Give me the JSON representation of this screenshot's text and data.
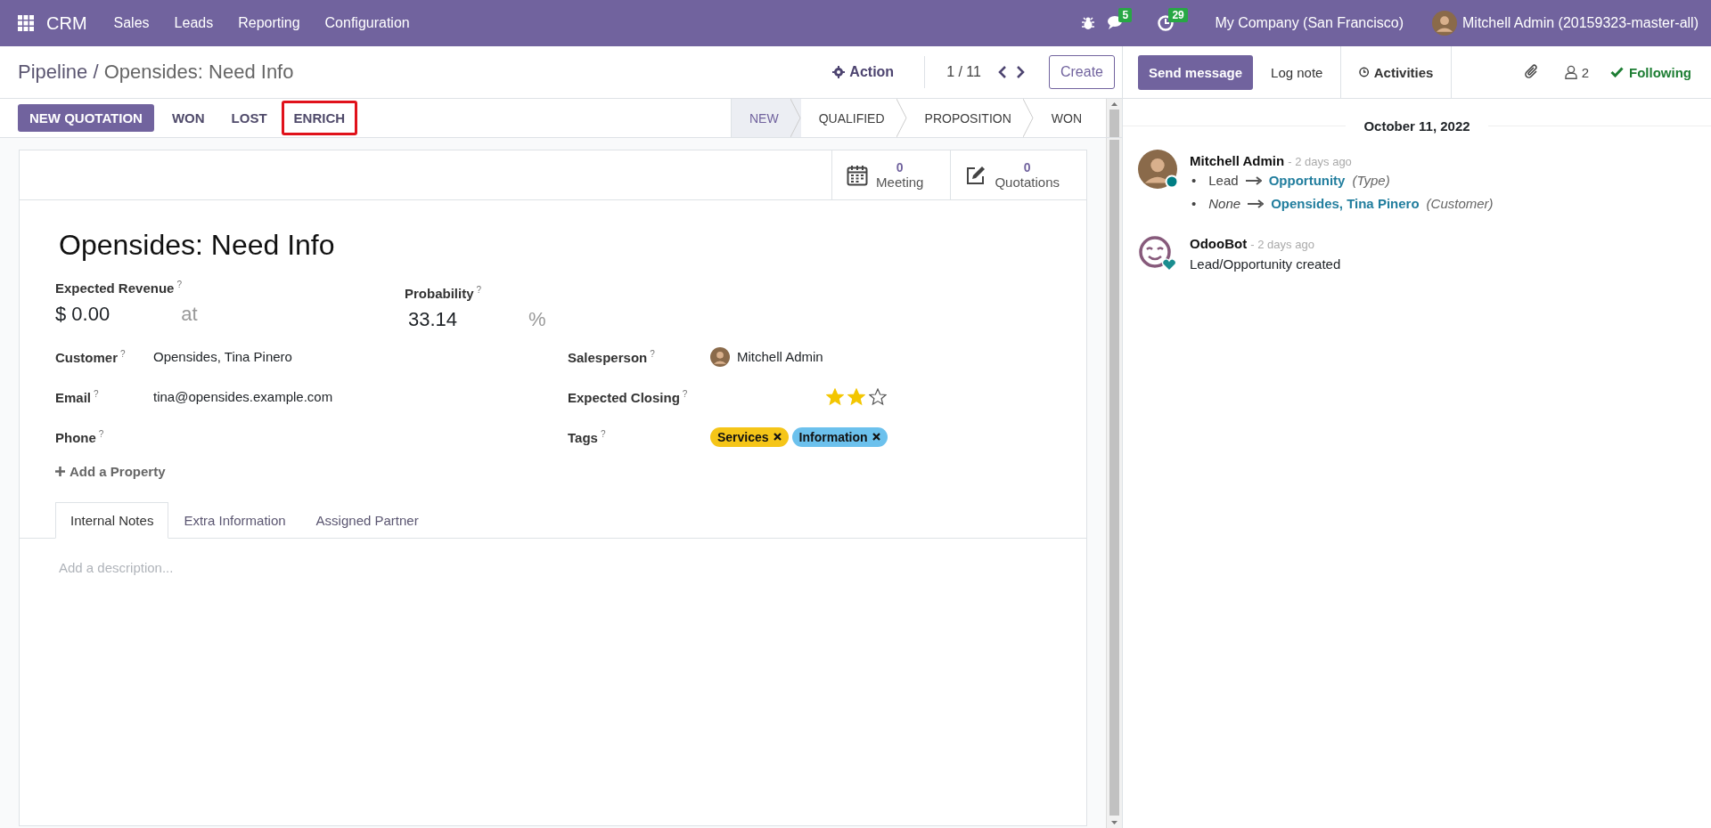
{
  "navbar": {
    "app": "CRM",
    "menus": [
      "Sales",
      "Leads",
      "Reporting",
      "Configuration"
    ],
    "messages_count": "5",
    "activities_count": "29",
    "company": "My Company (San Francisco)",
    "user": "Mitchell Admin (20159323-master-all)"
  },
  "breadcrumb": {
    "parent": "Pipeline",
    "separator": "/",
    "current": "Opensides: Need Info"
  },
  "action": "Action",
  "pager": "1 / 11",
  "create": "Create",
  "buttons": [
    {
      "label": "NEW QUOTATION",
      "kind": "primary",
      "highlighted": false
    },
    {
      "label": "WON",
      "kind": "secondary",
      "highlighted": false
    },
    {
      "label": "LOST",
      "kind": "secondary",
      "highlighted": false
    },
    {
      "label": "ENRICH",
      "kind": "secondary",
      "highlighted": true
    }
  ],
  "stages": [
    {
      "label": "NEW",
      "selected": true
    },
    {
      "label": "QUALIFIED",
      "selected": false
    },
    {
      "label": "PROPOSITION",
      "selected": false
    },
    {
      "label": "WON",
      "selected": false
    }
  ],
  "smart_buttons": [
    {
      "kind": "calendar",
      "count": "0",
      "label": "Meeting"
    },
    {
      "kind": "edit",
      "count": "0",
      "label": "Quotations"
    }
  ],
  "title": "Opensides: Need Info",
  "expected_revenue": {
    "label": "Expected Revenue",
    "help": "?",
    "value": "$ 0.00",
    "at": "at"
  },
  "probability": {
    "label": "Probability",
    "help": "?",
    "value": "33.14",
    "unit": "%"
  },
  "fields_left": [
    {
      "label": "Customer",
      "help": "?",
      "value": "Opensides, Tina Pinero"
    },
    {
      "label": "Email",
      "help": "?",
      "value": "tina@opensides.example.com"
    },
    {
      "label": "Phone",
      "help": "?"
    }
  ],
  "fields_right": [
    {
      "kind": "user",
      "label": "Salesperson",
      "help": "?",
      "value": "Mitchell Admin"
    },
    {
      "kind": "stars",
      "label": "Expected Closing",
      "help": "?",
      "stars": 2
    },
    {
      "kind": "tags",
      "label": "Tags",
      "help": "?",
      "tags": [
        {
          "label": "Services",
          "color": "#f5c518"
        },
        {
          "label": "Information",
          "color": "#6cc1ed"
        }
      ]
    }
  ],
  "add_property": "Add a Property",
  "tabs": [
    {
      "label": "Internal Notes",
      "selected": true
    },
    {
      "label": "Extra Information",
      "selected": false
    },
    {
      "label": "Assigned Partner",
      "selected": false
    }
  ],
  "description": {
    "placeholder": "Add a description..."
  },
  "chatter": {
    "send": "Send message",
    "log": "Log note",
    "activities": "Activities",
    "followers": "2",
    "following": "Following",
    "date": "October 11, 2022",
    "messages": [
      {
        "kind": "user",
        "author": "Mitchell Admin",
        "time": "- 2 days ago",
        "online": true,
        "changes": [
          {
            "kind": "value",
            "bullet": "•",
            "old": "Lead",
            "new": "Opportunity",
            "field": "(Type)"
          },
          {
            "kind": "none",
            "bullet": "•",
            "old": "None",
            "new": "Opensides, Tina Pinero",
            "field": "(Customer)"
          }
        ]
      },
      {
        "kind": "bot",
        "author": "OdooBot",
        "time": "- 2 days ago",
        "online": false,
        "body": "Lead/Opportunity created"
      }
    ]
  }
}
